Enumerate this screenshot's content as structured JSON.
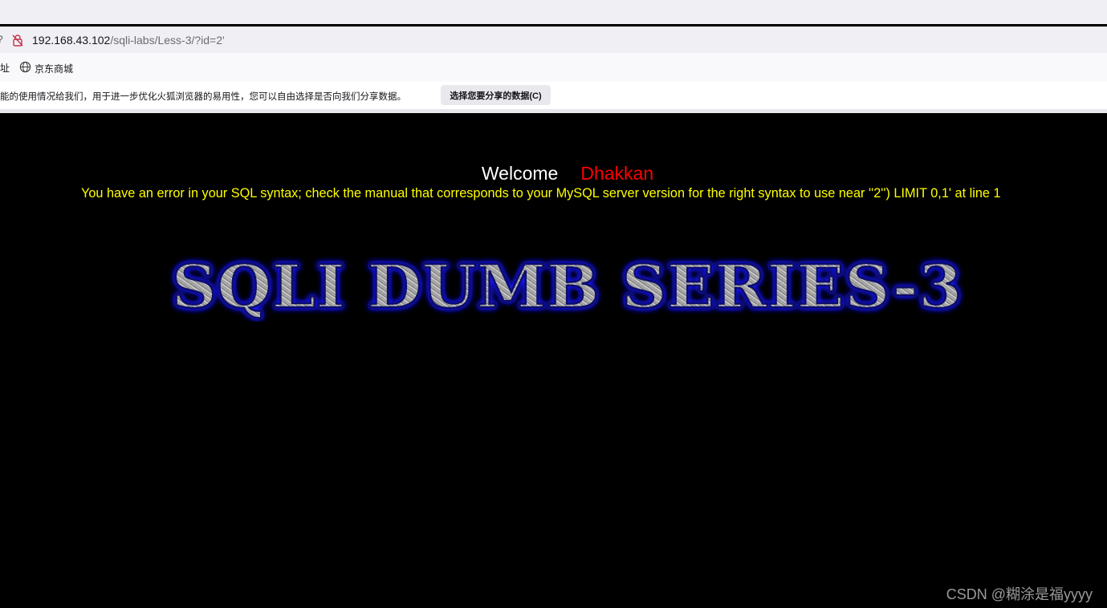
{
  "address_bar": {
    "lead_glyph": "?",
    "url_host": "192.168.43.102",
    "url_path": "/sqli-labs/Less-3/?id=2'"
  },
  "bookmarks": {
    "cut_label": "址",
    "items": [
      {
        "label": "京东商城",
        "icon": "globe-icon"
      }
    ]
  },
  "notification": {
    "text": "能的使用情况给我们，用于进一步优化火狐浏览器的易用性，您可以自由选择是否向我们分享数据。",
    "button_label": "选择您要分享的数据(C)"
  },
  "page": {
    "welcome_label": "Welcome",
    "user_name": "Dhakkan",
    "error_message": "You have an error in your SQL syntax; check the manual that corresponds to your MySQL server version for the right syntax to use near ''2'') LIMIT 0,1' at line 1",
    "series_title": "SQLI DUMB SERIES-3"
  },
  "watermark": "CSDN @糊涂是福yyyy",
  "colors": {
    "background": "#000000",
    "welcome": "#ffffff",
    "user_name": "#ff0000",
    "error": "#ffff00",
    "title_glow": "#1a1aff",
    "title_fill": "#9a9a9a"
  }
}
